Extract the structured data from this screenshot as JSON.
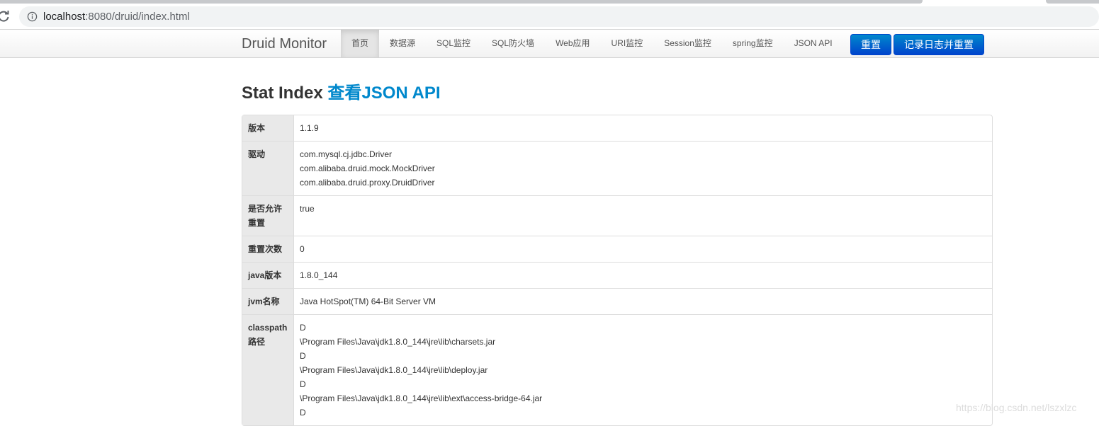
{
  "browser": {
    "url_host": "localhost",
    "url_rest": ":8080/druid/index.html"
  },
  "navbar": {
    "brand": "Druid Monitor",
    "items": [
      {
        "label": "首页",
        "active": true
      },
      {
        "label": "数据源"
      },
      {
        "label": "SQL监控"
      },
      {
        "label": "SQL防火墙"
      },
      {
        "label": "Web应用"
      },
      {
        "label": "URI监控"
      },
      {
        "label": "Session监控"
      },
      {
        "label": "spring监控"
      },
      {
        "label": "JSON API"
      }
    ],
    "reset_label": "重置",
    "log_reset_label": "记录日志并重置"
  },
  "page": {
    "title": "Stat Index",
    "json_link": "查看JSON API"
  },
  "stat_table": {
    "version_key": "版本",
    "version_val": "1.1.9",
    "driver_key": "驱动",
    "drivers": [
      "com.mysql.cj.jdbc.Driver",
      "com.alibaba.druid.mock.MockDriver",
      "com.alibaba.druid.proxy.DruidDriver"
    ],
    "allow_reset_key_1": "是否允许",
    "allow_reset_key_2": "重置",
    "allow_reset_val": "true",
    "reset_count_key": "重置次数",
    "reset_count_val": "0",
    "java_version_key": "java版本",
    "java_version_val": "1.8.0_144",
    "jvm_name_key": "jvm名称",
    "jvm_name_val": "Java HotSpot(TM) 64-Bit Server VM",
    "classpath_key_1": "classpath",
    "classpath_key_2": "路径",
    "classpath_lines": [
      "D",
      "\\Program Files\\Java\\jdk1.8.0_144\\jre\\lib\\charsets.jar",
      "D",
      "\\Program Files\\Java\\jdk1.8.0_144\\jre\\lib\\deploy.jar",
      "D",
      "\\Program Files\\Java\\jdk1.8.0_144\\jre\\lib\\ext\\access-bridge-64.jar",
      "D"
    ]
  },
  "watermark": "https://blog.csdn.net/lszxlzc",
  "colors": {
    "link": "#0088cc",
    "button": "#0044cc",
    "key_bg": "#e9e9e9"
  }
}
